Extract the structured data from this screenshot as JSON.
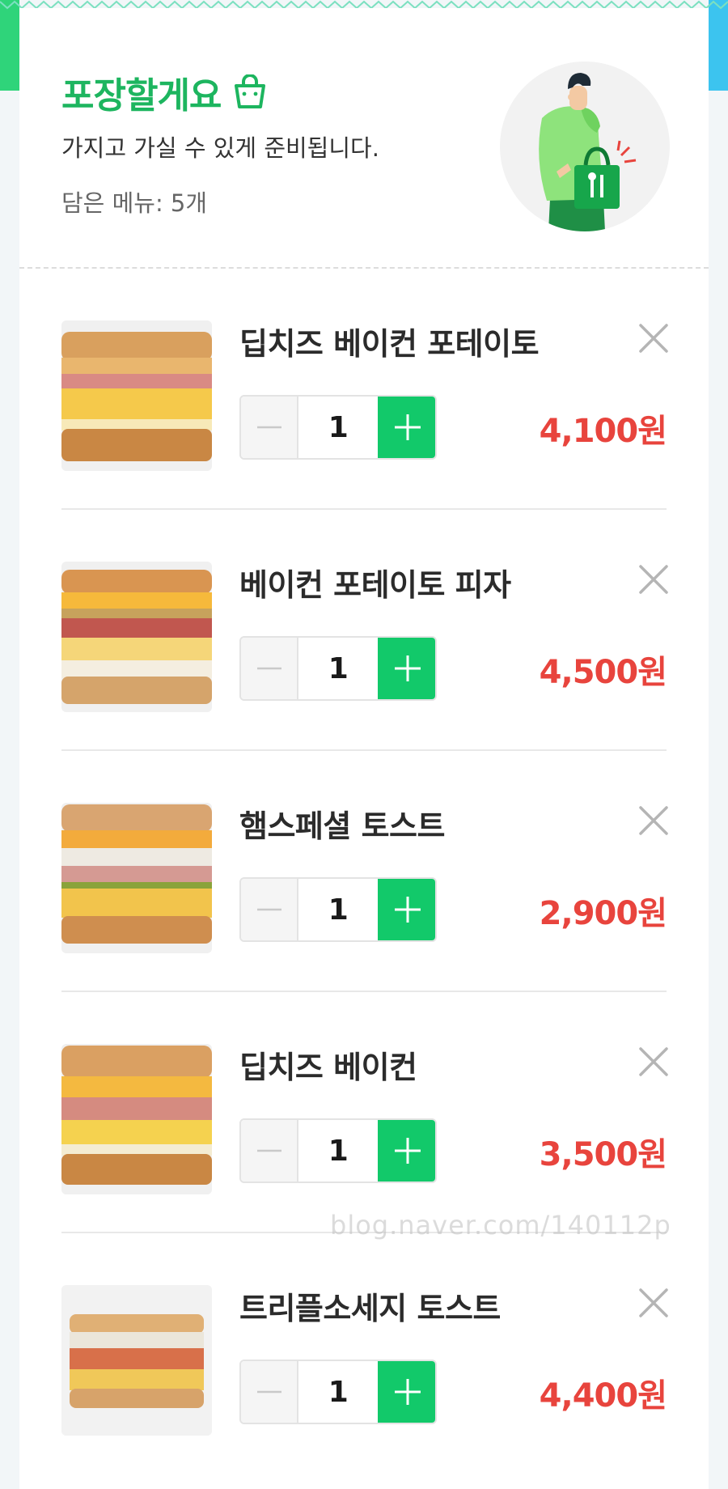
{
  "header": {
    "title": "포장할게요",
    "subtitle": "가지고 가실 수 있게 준비됩니다.",
    "menu_count": "담은 메뉴: 5개"
  },
  "items": [
    {
      "name": "딥치즈 베이컨 포테이토",
      "qty": "1",
      "price": "4,100원"
    },
    {
      "name": "베이컨 포테이토 피자",
      "qty": "1",
      "price": "4,500원"
    },
    {
      "name": "햄스페셜 토스트",
      "qty": "1",
      "price": "2,900원"
    },
    {
      "name": "딥치즈 베이컨",
      "qty": "1",
      "price": "3,500원"
    },
    {
      "name": "트리플소세지 토스트",
      "qty": "1",
      "price": "4,400원"
    }
  ],
  "watermark": "blog.naver.com/140112p",
  "colors": {
    "accent": "#1db55f",
    "plus_button": "#12c96a",
    "price": "#e8443d"
  },
  "icons": {
    "title_icon": "shopping-bag-icon",
    "close": "close-icon",
    "minus": "minus-icon",
    "plus": "plus-icon"
  }
}
